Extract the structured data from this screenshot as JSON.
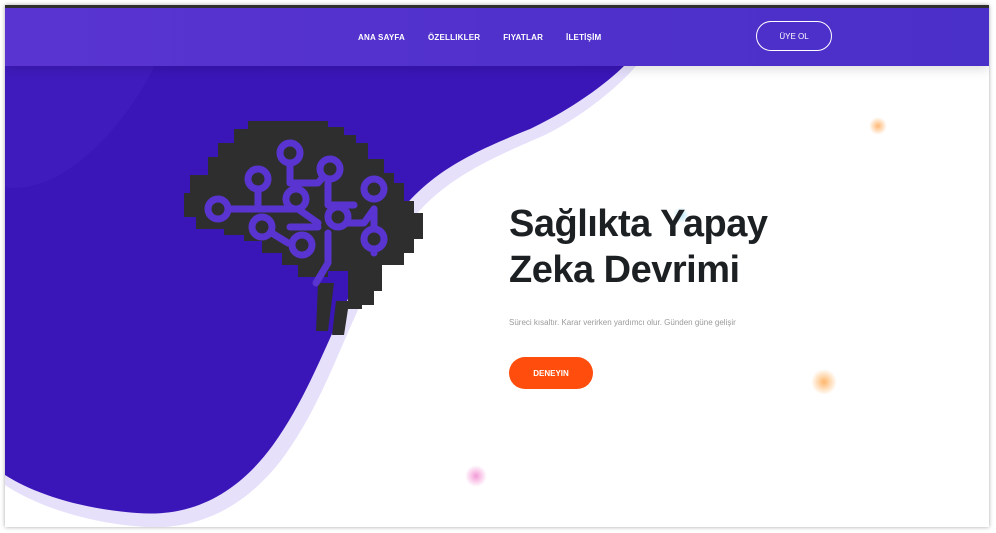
{
  "nav": {
    "links": [
      "ANA SAYFA",
      "ÖZELLIKLER",
      "FIYATLAR",
      "İLETİŞİM"
    ],
    "signup_label": "ÜYE OL"
  },
  "hero": {
    "title_line1": "Sağlıkta Yapay",
    "title_line2": "Zeka Devrimi",
    "subtitle": "Süreci kısaltır. Karar verirken yardımcı olur. Günden güne gelişir",
    "cta_label": "DENEYIN",
    "illustration": "brain-circuit-icon"
  },
  "colors": {
    "nav_bg": "#5131cc",
    "blob": "#3a16b8",
    "blob_shadow": "#e6e0fb",
    "title": "#1d2023",
    "cta": "#ff4d0d",
    "brain": "#2e2e2e",
    "circuit": "#5a34d0"
  }
}
